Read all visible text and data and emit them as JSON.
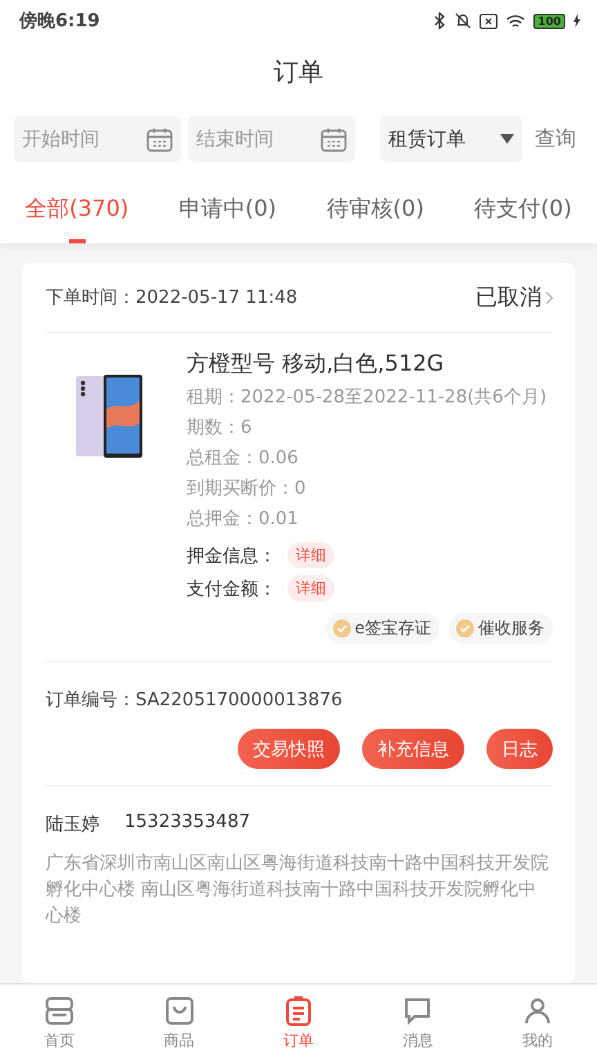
{
  "status_bar": {
    "time": "傍晚6:19",
    "battery": "100"
  },
  "title": "订单",
  "filters": {
    "start": {
      "placeholder": "开始时间"
    },
    "end": {
      "placeholder": "结束时间"
    },
    "type": {
      "value": "租赁订单"
    },
    "query": "查询"
  },
  "tabs": [
    {
      "label": "全部(370)",
      "selected": true
    },
    {
      "label": "申请中(0)",
      "selected": false
    },
    {
      "label": "待审核(0)",
      "selected": false
    },
    {
      "label": "待支付(0)",
      "selected": false
    }
  ],
  "order": {
    "time_label": "下单时间：",
    "time": "2022-05-17 11:48",
    "status": "已取消",
    "product": {
      "name": "方橙型号 移动,白色,512G",
      "details": [
        "租期：2022-05-28至2022-11-28(共6个月)",
        "期数：6",
        "总租金：0.06",
        "到期买断价：0",
        "总押金：0.01"
      ],
      "links": [
        {
          "label": "押金信息：",
          "action": "详细"
        },
        {
          "label": "支付金额：",
          "action": "详细"
        }
      ]
    },
    "services": [
      "e签宝存证",
      "催收服务"
    ],
    "number": "订单编号：SA2205170000013876",
    "actions": [
      "交易快照",
      "补充信息",
      "日志"
    ],
    "customer": {
      "name": "陆玉婷",
      "phone": "15323353487",
      "address": "广东省深圳市南山区南山区粤海街道科技南十路中国科技开发院孵化中心楼 南山区粤海街道科技南十路中国科技开发院孵化中心楼"
    }
  },
  "nav": [
    {
      "label": "首页",
      "kind": "home",
      "selected": false
    },
    {
      "label": "商品",
      "kind": "bag",
      "selected": false
    },
    {
      "label": "订单",
      "kind": "clipboard",
      "selected": true
    },
    {
      "label": "消息",
      "kind": "chat",
      "selected": false
    },
    {
      "label": "我的",
      "kind": "person",
      "selected": false
    }
  ]
}
